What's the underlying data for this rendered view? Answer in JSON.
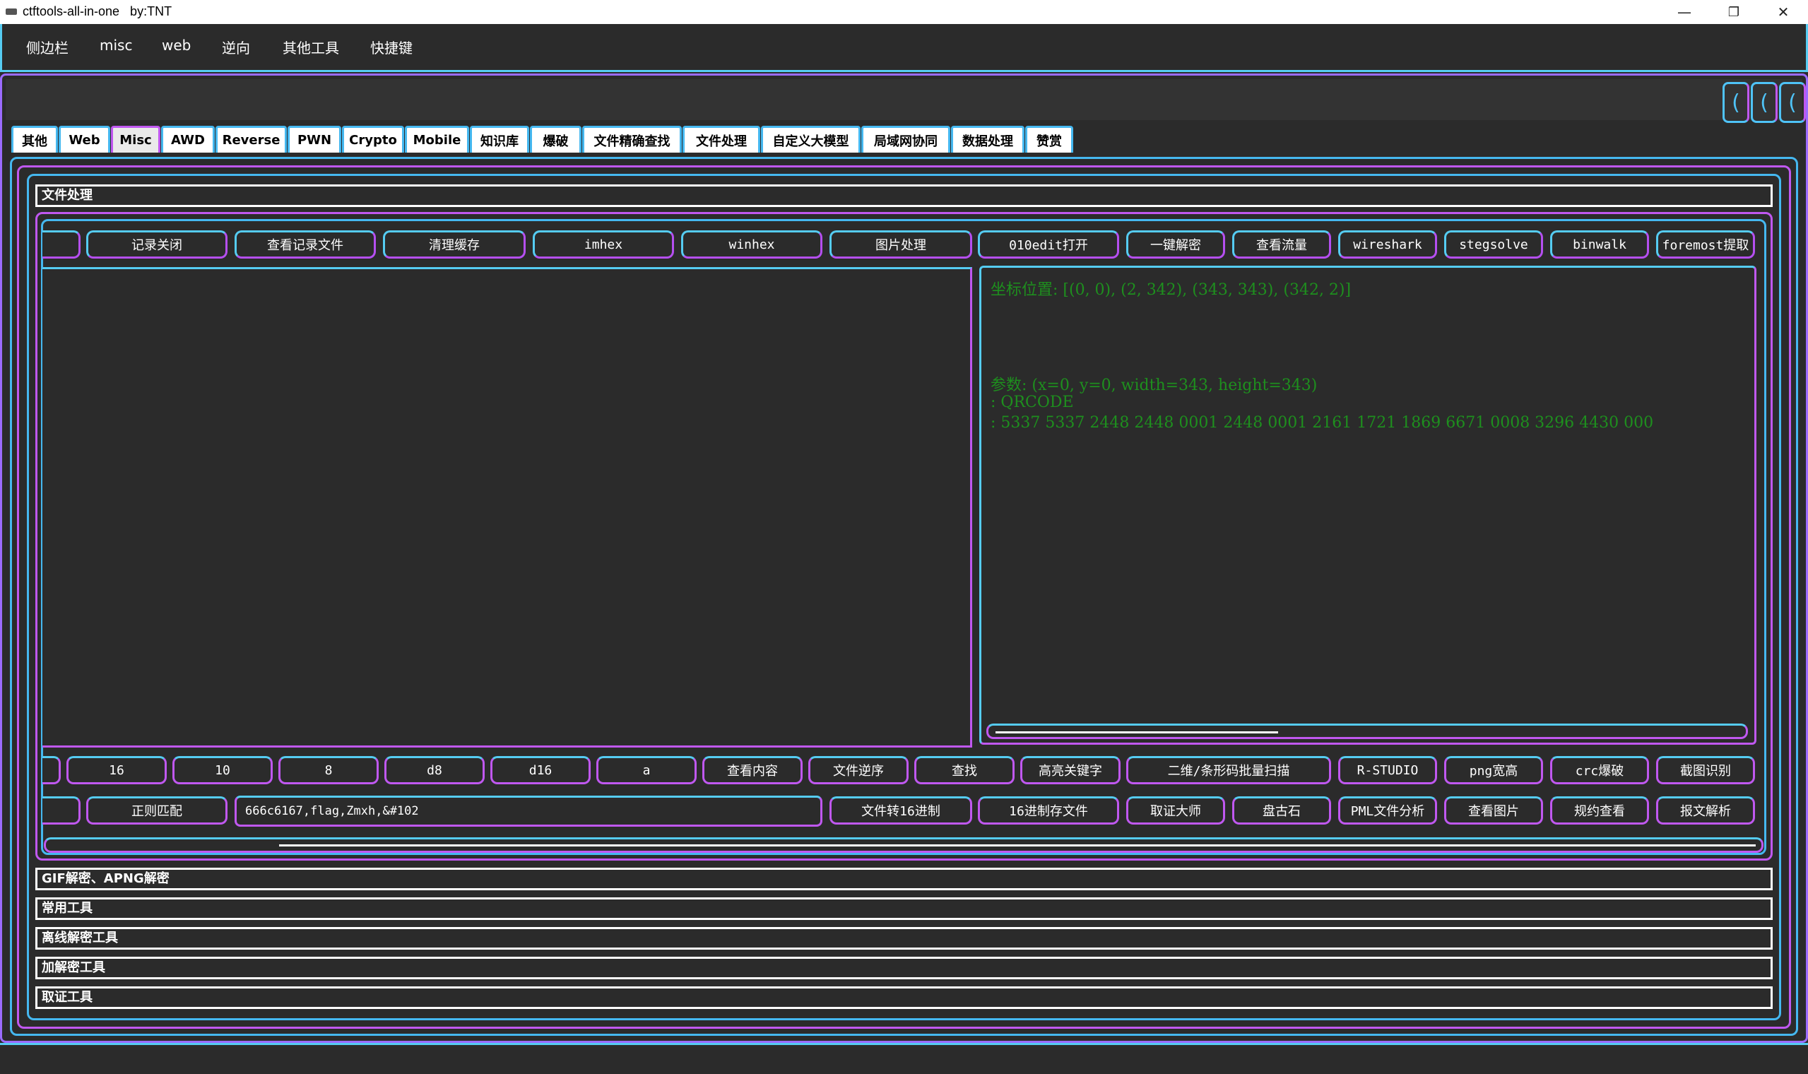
{
  "window": {
    "title": "ctftools-all-in-one   by:TNT",
    "minimize": "—",
    "maximize": "❐",
    "close": "✕"
  },
  "menu": [
    "侧边栏",
    "misc",
    "web",
    "逆向",
    "其他工具",
    "快捷键"
  ],
  "top_caps": [
    "(",
    "(",
    "("
  ],
  "tabs": [
    "其他",
    "Web",
    "Misc",
    "AWD",
    "Reverse",
    "PWN",
    "Crypto",
    "Mobile",
    "知识库",
    "爆破",
    "文件精确查找",
    "文件处理",
    "自定义大模型",
    "局域网协同",
    "数据处理",
    "赞赏"
  ],
  "active_tab": "Misc",
  "sections": {
    "file_processing": "文件处理",
    "gif_apng": "GIF解密、APNG解密",
    "common_tools": "常用工具",
    "offline_tools": "离线解密工具",
    "crypto_tools": "加解密工具",
    "forensics_tools": "取证工具"
  },
  "toolbar_top": [
    "记录关闭",
    "查看记录文件",
    "清理缓存",
    "imhex",
    "winhex",
    "图片处理",
    "010edit打开",
    "一键解密",
    "查看流量",
    "wireshark",
    "stegsolve",
    "binwalk",
    "foremost提取"
  ],
  "output": {
    "line1": "坐标位置: [(0, 0), (2, 342), (343, 343), (342, 2)]",
    "line2": "参数: (x=0, y=0, width=343, height=343)",
    "line3": ": QRCODE",
    "line4": ": 5337 5337 2448 2448 0001 2448 0001 2161 1721 1869 6671 0008 3296 4430 000"
  },
  "toolbar_row2": [
    "16",
    "10",
    "8",
    "d8",
    "d16",
    "a",
    "查看内容",
    "文件逆序",
    "查找",
    "高亮关键字",
    "二维/条形码批量扫描",
    "R-STUDIO",
    "png宽高",
    "crc爆破",
    "截图识别"
  ],
  "toolbar_row3": {
    "regex_button": "正则匹配",
    "regex_input": "666c6167,flag,Zmxh,&#102",
    "buttons": [
      "文件转16进制",
      "16进制存文件",
      "取证大师",
      "盘古石",
      "PML文件分析",
      "查看图片",
      "规约查看",
      "报文解析"
    ]
  }
}
